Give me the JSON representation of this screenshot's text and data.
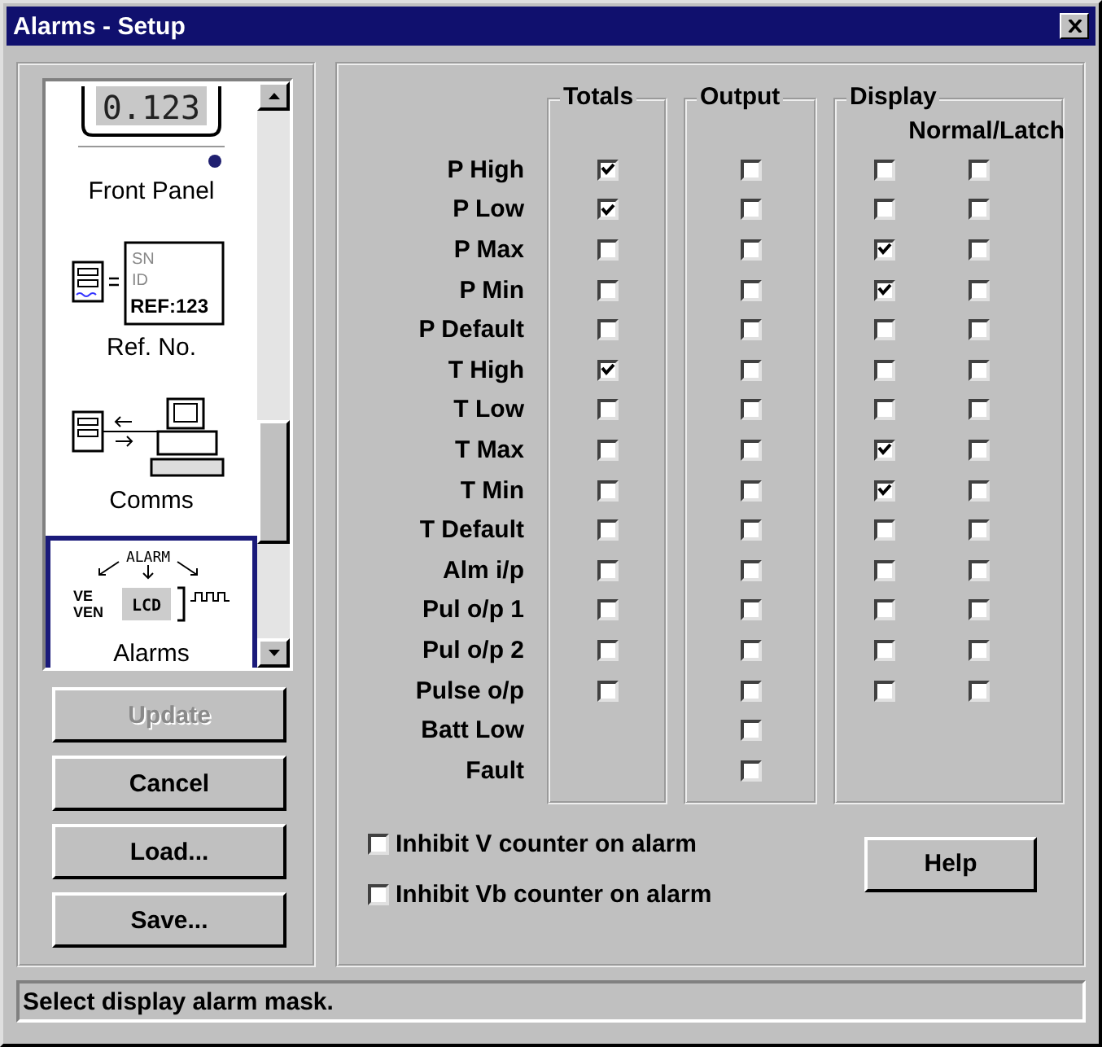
{
  "window": {
    "title": "Alarms - Setup"
  },
  "sidebar": {
    "items": [
      {
        "kind": "front-panel",
        "label": "Front Panel",
        "icon_text": [
          "0.123"
        ],
        "selected": false
      },
      {
        "kind": "ref",
        "label": "Ref. No.",
        "icon_text": [
          "SN",
          "ID",
          "REF:123"
        ],
        "selected": false
      },
      {
        "kind": "comms",
        "label": "Comms",
        "selected": false
      },
      {
        "kind": "alarms",
        "label": "Alarms",
        "icon_text": [
          "ALARM",
          "VE",
          "VEN",
          "LCD"
        ],
        "selected": true
      }
    ]
  },
  "buttons": [
    {
      "label": "Update",
      "disabled": true
    },
    {
      "label": "Cancel",
      "disabled": false
    },
    {
      "label": "Load...",
      "disabled": false
    },
    {
      "label": "Save...",
      "disabled": false
    }
  ],
  "columns": {
    "totals": "Totals",
    "output": "Output",
    "display": "Display",
    "display_sub": "Normal/Latch"
  },
  "rows": [
    {
      "label": "P High",
      "totals": true,
      "output": false,
      "normal": false,
      "latch": false
    },
    {
      "label": "P Low",
      "totals": true,
      "output": false,
      "normal": false,
      "latch": false
    },
    {
      "label": "P Max",
      "totals": false,
      "output": false,
      "normal": true,
      "latch": false
    },
    {
      "label": "P Min",
      "totals": false,
      "output": false,
      "normal": true,
      "latch": false
    },
    {
      "label": "P Default",
      "totals": false,
      "output": false,
      "normal": false,
      "latch": false
    },
    {
      "label": "T High",
      "totals": true,
      "output": false,
      "normal": false,
      "latch": false
    },
    {
      "label": "T Low",
      "totals": false,
      "output": false,
      "normal": false,
      "latch": false
    },
    {
      "label": "T Max",
      "totals": false,
      "output": false,
      "normal": true,
      "latch": false
    },
    {
      "label": "T Min",
      "totals": false,
      "output": false,
      "normal": true,
      "latch": false
    },
    {
      "label": "T Default",
      "totals": false,
      "output": false,
      "normal": false,
      "latch": false
    },
    {
      "label": "Alm i/p",
      "totals": false,
      "output": false,
      "normal": false,
      "latch": false
    },
    {
      "label": "Pul o/p 1",
      "totals": false,
      "output": false,
      "normal": false,
      "latch": false
    },
    {
      "label": "Pul o/p 2",
      "totals": false,
      "output": false,
      "normal": false,
      "latch": false
    },
    {
      "label": "Pulse o/p",
      "totals": false,
      "output": false,
      "normal": false,
      "latch": false
    },
    {
      "label": "Batt Low",
      "output": false
    },
    {
      "label": "Fault",
      "output": false
    }
  ],
  "options": [
    {
      "label": "Inhibit V counter on alarm",
      "checked": false
    },
    {
      "label": "Inhibit Vb counter on alarm",
      "checked": false
    }
  ],
  "help_button": "Help",
  "status_bar": "Select display alarm mask."
}
